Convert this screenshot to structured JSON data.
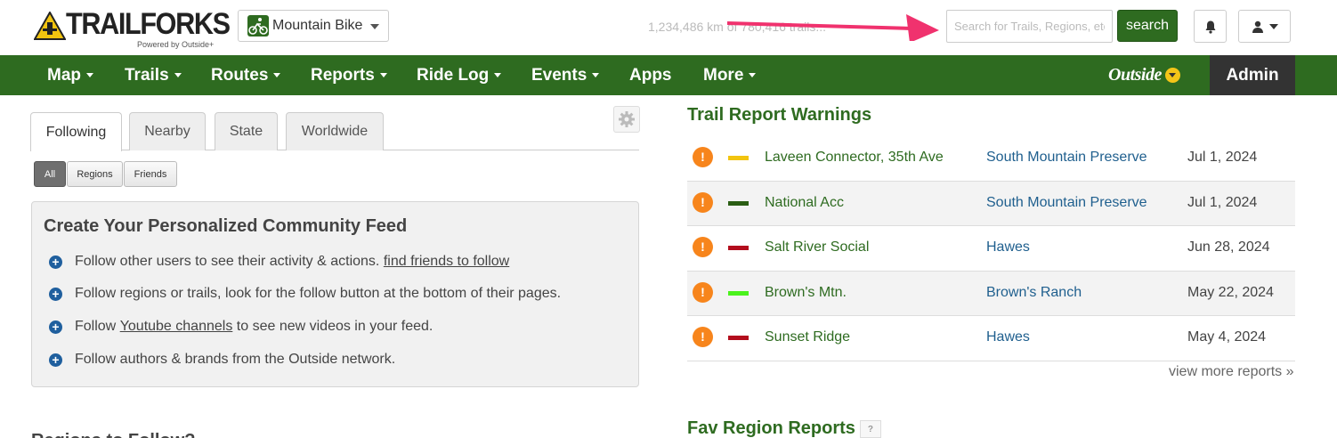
{
  "header": {
    "logo_text": "TRAILFORKS",
    "logo_subtitle": "Powered by Outside+",
    "sport_selector": {
      "value": "Mountain Bike",
      "icon": "mountain-bike-icon"
    },
    "stats_text": "1,234,486 km of 780,416 trails...",
    "search": {
      "placeholder": "Search for Trails, Regions, etc",
      "button_label": "search"
    },
    "icons": [
      "bell-icon",
      "user-icon"
    ],
    "accent_color": "#2e6b20",
    "arrow_color": "#f0326e"
  },
  "nav": {
    "items": [
      {
        "label": "Map",
        "dropdown": true
      },
      {
        "label": "Trails",
        "dropdown": true
      },
      {
        "label": "Routes",
        "dropdown": true
      },
      {
        "label": "Reports",
        "dropdown": true
      },
      {
        "label": "Ride Log",
        "dropdown": true
      },
      {
        "label": "Events",
        "dropdown": true
      },
      {
        "label": "Apps",
        "dropdown": false
      },
      {
        "label": "More",
        "dropdown": true
      }
    ],
    "brand": "Outside",
    "admin_label": "Admin"
  },
  "feed": {
    "tabs": [
      "Following",
      "Nearby",
      "State",
      "Worldwide"
    ],
    "active_tab": "Following",
    "filters": [
      "All",
      "Regions",
      "Friends"
    ],
    "active_filter": "All",
    "box_title": "Create Your Personalized Community Feed",
    "items": [
      {
        "text": "Follow other users to see their activity & actions.",
        "link": "find friends to follow",
        "after": ""
      },
      {
        "text": "Follow regions or trails, look for the follow button at the bottom of their pages.",
        "link": "",
        "after": ""
      },
      {
        "text": "Follow",
        "link": "Youtube channels",
        "after": "to see new videos in your feed."
      },
      {
        "text": "Follow authors & brands from the Outside network.",
        "link": "",
        "after": ""
      }
    ],
    "next_heading": "Regions to Follow?"
  },
  "reports": {
    "title": "Trail Report Warnings",
    "rows": [
      {
        "trail": "Laveen Connector, 35th Ave",
        "region": "South Mountain Preserve",
        "date": "Jul 1, 2024",
        "condition_color": "#f2c40f"
      },
      {
        "trail": "National Acc",
        "region": "South Mountain Preserve",
        "date": "Jul 1, 2024",
        "condition_color": "#2b5e14"
      },
      {
        "trail": "Salt River Social",
        "region": "Hawes",
        "date": "Jun 28, 2024",
        "condition_color": "#b30d1d"
      },
      {
        "trail": "Brown's Mtn.",
        "region": "Brown's Ranch",
        "date": "May 22, 2024",
        "condition_color": "#4af21c"
      },
      {
        "trail": "Sunset Ridge",
        "region": "Hawes",
        "date": "May 4, 2024",
        "condition_color": "#b30d1d"
      }
    ],
    "view_more": "view more reports »",
    "fav_title": "Fav Region Reports",
    "fav_help": "?"
  }
}
